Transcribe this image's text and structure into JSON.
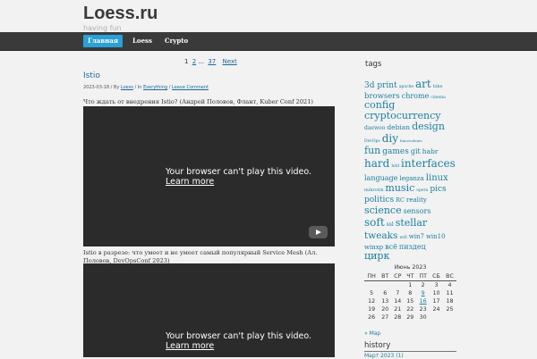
{
  "site": {
    "title": "Loess.ru",
    "tagline": "having fun"
  },
  "nav": [
    {
      "label": "Главная"
    },
    {
      "label": "Loess"
    },
    {
      "label": "Crypto"
    }
  ],
  "pagination": {
    "current": "1",
    "pages": [
      "2",
      "37"
    ],
    "ellipsis": "...",
    "next": "Next"
  },
  "post": {
    "title": "Istio",
    "meta_date": "2023-03-18 / By ",
    "meta_author": "Loess",
    "meta_in": " / In ",
    "meta_category": "Everything",
    "meta_sep": " / ",
    "meta_comment": "Leave Comment",
    "line1": "Что ждать от внедрения Istio? (Андрей Половов, Флант, Kuber Conf 2021)",
    "line2": "Istio в разрезе: что умеет и не умеет самый популярный Service Mesh (Ал.",
    "line3": "Половов, DevOpsConf 2023)"
  },
  "video": {
    "message": "Your browser can't play this video.",
    "learn_more": "Learn more"
  },
  "sidebar": {
    "tags_heading": "tags",
    "tags": [
      [
        {
          "t": "3d print",
          "s": 9
        },
        {
          "t": "apache",
          "s": 4.5
        },
        {
          "t": "art",
          "s": 12
        },
        {
          "t": "bike",
          "s": 5
        }
      ],
      [
        {
          "t": "browsers",
          "s": 8.5
        },
        {
          "t": "chrome",
          "s": 8
        },
        {
          "t": "cinema",
          "s": 4.5
        }
      ],
      [
        {
          "t": "config",
          "s": 11
        }
      ],
      [
        {
          "t": "cryptocurrency",
          "s": 11
        }
      ],
      [
        {
          "t": "daewoo",
          "s": 6
        },
        {
          "t": "debian",
          "s": 7.5
        },
        {
          "t": "design",
          "s": 11
        }
      ],
      [
        {
          "t": "DevOps",
          "s": 4.5
        },
        {
          "t": "diy",
          "s": 12
        },
        {
          "t": "fanovodenie",
          "s": 4
        }
      ],
      [
        {
          "t": "fun",
          "s": 11
        },
        {
          "t": "games",
          "s": 9
        },
        {
          "t": "git",
          "s": 8
        },
        {
          "t": "habr",
          "s": 7.5
        }
      ],
      [
        {
          "t": "hard",
          "s": 12
        },
        {
          "t": "hdd",
          "s": 4.5
        },
        {
          "t": "interfaces",
          "s": 12
        }
      ],
      [
        {
          "t": "language",
          "s": 8
        },
        {
          "t": "leganza",
          "s": 7
        },
        {
          "t": "linux",
          "s": 10
        }
      ],
      [
        {
          "t": "mikrotik",
          "s": 5
        },
        {
          "t": "music",
          "s": 11
        },
        {
          "t": "opera",
          "s": 4.5
        },
        {
          "t": "pics",
          "s": 9
        }
      ],
      [
        {
          "t": "politics",
          "s": 9
        },
        {
          "t": "RC",
          "s": 6.5
        },
        {
          "t": "reality",
          "s": 7
        }
      ],
      [
        {
          "t": "science",
          "s": 11
        },
        {
          "t": "sensors",
          "s": 8
        }
      ],
      [
        {
          "t": "soft",
          "s": 12
        },
        {
          "t": "ssl",
          "s": 6
        },
        {
          "t": "stellar",
          "s": 11
        }
      ],
      [
        {
          "t": "tweaks",
          "s": 10.5
        },
        {
          "t": "wifi",
          "s": 4.5
        },
        {
          "t": "win7",
          "s": 7
        },
        {
          "t": "win10",
          "s": 7
        }
      ],
      [
        {
          "t": "winxp",
          "s": 7
        },
        {
          "t": "всё",
          "s": 8
        },
        {
          "t": "пиздец",
          "s": 8
        }
      ],
      [
        {
          "t": "цирк",
          "s": 11
        }
      ]
    ],
    "calendar": {
      "caption": "Июнь 2023",
      "days": [
        "ПН",
        "ВТ",
        "СР",
        "ЧТ",
        "ПТ",
        "СБ",
        "ВС"
      ],
      "weeks": [
        [
          "",
          "",
          "",
          "1",
          "2",
          "3",
          "4"
        ],
        [
          "5",
          "6",
          "7",
          "8",
          "9",
          "10",
          "11"
        ],
        [
          "12",
          "13",
          "14",
          "15",
          "16",
          "17",
          "18"
        ],
        [
          "19",
          "20",
          "21",
          "22",
          "23",
          "24",
          "25"
        ],
        [
          "26",
          "27",
          "28",
          "29",
          "30",
          "",
          ""
        ]
      ],
      "links": [
        "9",
        "16"
      ],
      "prev": "« Мар"
    },
    "history_heading": "history",
    "history_item": "Март 2023 (1)"
  }
}
